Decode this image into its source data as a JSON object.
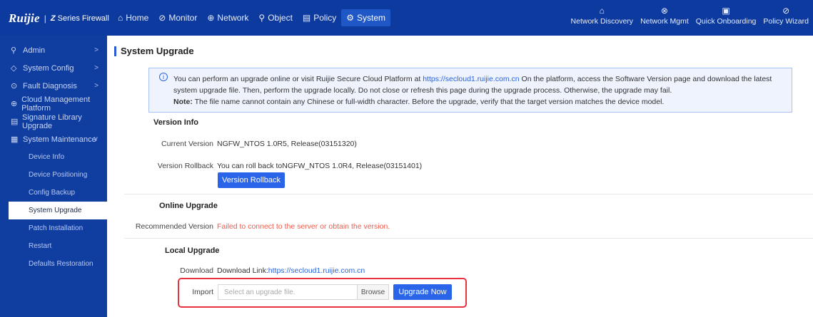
{
  "brand": {
    "logo": "Ruijie",
    "separator": "|",
    "product_prefix": "Z",
    "product": "Series Firewall"
  },
  "nav": [
    {
      "icon": "⌂",
      "label": "Home"
    },
    {
      "icon": "⊘",
      "label": "Monitor"
    },
    {
      "icon": "⊕",
      "label": "Network"
    },
    {
      "icon": "⚲",
      "label": "Object"
    },
    {
      "icon": "▤",
      "label": "Policy"
    },
    {
      "icon": "⚙",
      "label": "System"
    }
  ],
  "quick_links": [
    {
      "icon": "⌂",
      "label": "Network Discovery"
    },
    {
      "icon": "⊗",
      "label": "Network Mgmt"
    },
    {
      "icon": "▣",
      "label": "Quick Onboarding"
    },
    {
      "icon": "⊘",
      "label": "Policy Wizard"
    }
  ],
  "sidebar": {
    "items": [
      {
        "icon": "⚲",
        "label": "Admin",
        "chevron": ">"
      },
      {
        "icon": "◇",
        "label": "System Config",
        "chevron": ">"
      },
      {
        "icon": "⊙",
        "label": "Fault Diagnosis",
        "chevron": ">"
      },
      {
        "icon": "⊕",
        "label": "Cloud Management Platform"
      },
      {
        "icon": "▤",
        "label": "Signature Library Upgrade"
      },
      {
        "icon": "▦",
        "label": "System Maintenance",
        "chevron": "∨"
      }
    ],
    "sub_items": [
      "Device Info",
      "Device Positioning",
      "Config Backup",
      "System Upgrade",
      "Patch Installation",
      "Restart",
      "Defaults Restoration"
    ]
  },
  "page_title": "System Upgrade",
  "notice": {
    "text1": "You can perform an upgrade online or visit Ruijie Secure Cloud Platform at ",
    "link": "https://secloud1.ruijie.com.cn",
    "text2": " On the platform, access the Software Version page and download the latest system upgrade file. Then, perform the upgrade locally. Do not close or refresh this page during the upgrade process. Otherwise, the upgrade may fail.",
    "note_label": "Note:",
    "note_text": " The file name cannot contain any Chinese or full-width character. Before the upgrade, verify that the target version matches the device model."
  },
  "version_info": {
    "title": "Version Info",
    "current_label": "Current Version",
    "current_value": "NGFW_NTOS 1.0R5, Release(03151320)",
    "rollback_label": "Version Rollback",
    "rollback_value": "You can roll back toNGFW_NTOS 1.0R4, Release(03151401)",
    "rollback_button": "Version Rollback"
  },
  "online_upgrade": {
    "title": "Online Upgrade",
    "recommended_label": "Recommended Version",
    "recommended_value": "Failed to connect to the server or obtain the version."
  },
  "local_upgrade": {
    "title": "Local Upgrade",
    "download_label": "Download",
    "download_prefix": "Download Link:",
    "download_link": "https://secloud1.ruijie.com.cn",
    "import_label": "Import",
    "import_placeholder": "Select an upgrade file.",
    "browse": "Browse",
    "upgrade_button": "Upgrade Now"
  },
  "colors": {
    "topbar": "#0d3a9e",
    "sidebar": "#103ea0",
    "accent": "#2a64e8",
    "error": "#f05a4b",
    "highlight": "#e8333f"
  }
}
